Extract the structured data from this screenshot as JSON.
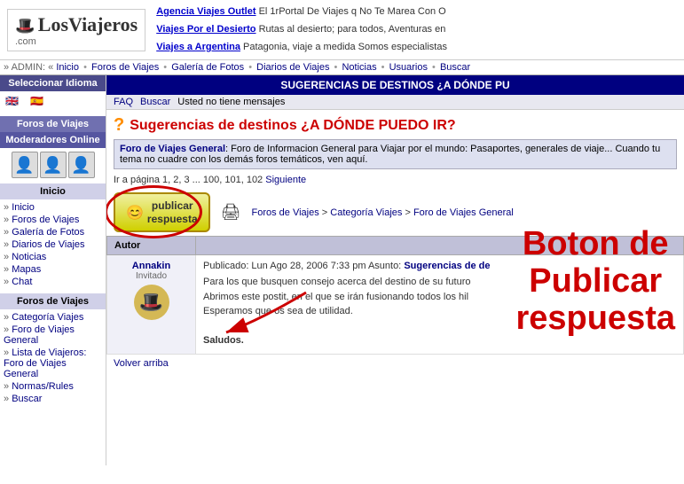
{
  "site": {
    "logo": "LosViajeros",
    "logo_sub": ".com"
  },
  "ads": [
    {
      "link": "Agencia Viajes Outlet",
      "text": " El 1rPortal De Viajes q No Te Marea Con O"
    },
    {
      "link": "Viajes Por el Desierto",
      "text": " Rutas al desierto; para todos, Aventuras en"
    },
    {
      "link": "Viajes a Argentina",
      "text": " Patagonia, viaje a medida Somos especialistas"
    }
  ],
  "nav": {
    "admin_label": "» ADMIN: «",
    "items": [
      "Inicio",
      "Foros de Viajes",
      "Galería de Fotos",
      "Diarios de Viajes",
      "Noticias",
      "Usuarios",
      "Buscar"
    ]
  },
  "sidebar": {
    "language_header": "Seleccionar Idioma",
    "forums_header": "Foros de Viajes",
    "moderators_header": "Moderadores Online",
    "inicio_label": "Inicio",
    "nav_links": [
      "Inicio",
      "Foros de Viajes",
      "Galería de Fotos",
      "Diarios de Viajes",
      "Noticias",
      "Mapas",
      "Chat"
    ],
    "foros_viajes_label": "Foros de Viajes",
    "foros_links": [
      "Categoría Viajes",
      "Foro de Viajes General",
      "Lista de Viajeros: Foro de Viajes General",
      "Normas/Rules",
      "Buscar"
    ]
  },
  "content": {
    "header": "SUGERENCIAS DE DESTINOS ¿A DÓNDE PU",
    "subbar_items": [
      "FAQ",
      "Buscar",
      "Usted no tiene mensajes"
    ],
    "thread_title": "Sugerencias de destinos ¿A DÓNDE PUEDO IR?",
    "forum_info_link": "Foro de Viajes General",
    "forum_info_text": ": Foro de Informacion General para Viajar por el mundo: Pasaportes, generales de viaje... Cuando tu tema no cuadre con los demás foros temáticos, ven aquí.",
    "pagination": "Ir a página 1, 2, 3 ... 100, 101, 102",
    "pagination_next": "Siguiente",
    "publish_btn": "publicar\nrespuesta",
    "breadcrumb": "Foros de Viajes > Categoría Viajes > Foro de Viajes General",
    "annotation_text": "Boton de\nPublicar\nrespuesta",
    "table": {
      "col_autor": "Autor",
      "posts": [
        {
          "author": "Annakin",
          "rank": "Invitado",
          "post_header": "Publicado: Lun Ago 28, 2006 7:33 pm",
          "asunto_label": "Asunto:",
          "asunto_link": "Sugerencias de de",
          "text_lines": [
            "Para los que busquen consejo acerca del destino de su futuro",
            "Abrimos este postit, en el que se irán fusionando todos los hil",
            "Esperamos que os sea de utilidad.",
            "",
            "Saludos."
          ]
        }
      ]
    },
    "back_top": "Volver arriba"
  }
}
